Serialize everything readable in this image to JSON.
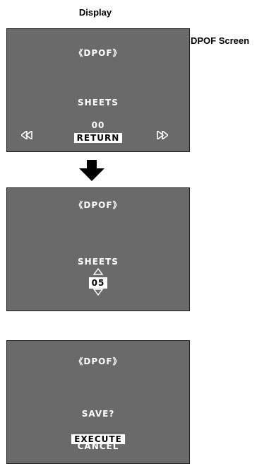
{
  "header": {
    "display_label": "Display",
    "screen_label": "DPOF Screen"
  },
  "screens": [
    {
      "title": "《DPOF》",
      "sheets_label": "SHEETS",
      "count": "00",
      "return_label": "RETURN"
    },
    {
      "title": "《DPOF》",
      "sheets_label": "SHEETS",
      "count": "05"
    },
    {
      "title": "《DPOF》",
      "prompt": "SAVE?",
      "execute_label": "EXECUTE",
      "cancel_label": "CANCEL"
    }
  ],
  "icons": {
    "rewind": "rewind-icon",
    "fast_forward": "fast-forward-icon",
    "down_arrow": "arrow-down-icon",
    "up_triangle": "triangle-up-icon",
    "down_triangle": "triangle-down-icon"
  }
}
